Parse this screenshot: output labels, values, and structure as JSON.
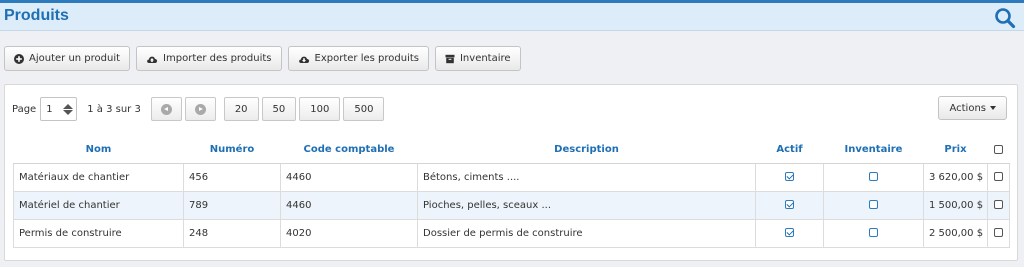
{
  "header": {
    "title": "Produits",
    "search_icon": "search-icon",
    "accent": "#1f6fb5",
    "background": "#dcecf9"
  },
  "toolbar": [
    {
      "label": "Ajouter un produit",
      "icon": "plus-circle-icon"
    },
    {
      "label": "Importer des produits",
      "icon": "cloud-upload-icon"
    },
    {
      "label": "Exporter les produits",
      "icon": "cloud-download-icon"
    },
    {
      "label": "Inventaire",
      "icon": "archive-icon"
    }
  ],
  "pagination": {
    "page_label": "Page",
    "page_value": "1",
    "range_text": "1 à 3 sur 3",
    "page_sizes": [
      "20",
      "50",
      "100",
      "500"
    ]
  },
  "actions_label": "Actions",
  "table": {
    "headers": [
      "Nom",
      "Numéro",
      "Code comptable",
      "Description",
      "Actif",
      "Inventaire",
      "Prix"
    ],
    "rows": [
      {
        "nom": "Matériaux de chantier",
        "numero": "456",
        "code": "4460",
        "description": "Bétons, ciments ....",
        "actif": true,
        "inventaire": false,
        "prix": "3 620,00 $"
      },
      {
        "nom": "Matériel de chantier",
        "numero": "789",
        "code": "4460",
        "description": "Pioches, pelles, sceaux ...",
        "actif": true,
        "inventaire": false,
        "prix": "1 500,00 $"
      },
      {
        "nom": "Permis de construire",
        "numero": "248",
        "code": "4020",
        "description": "Dossier de permis de construire",
        "actif": true,
        "inventaire": false,
        "prix": "2 500,00 $"
      }
    ]
  }
}
